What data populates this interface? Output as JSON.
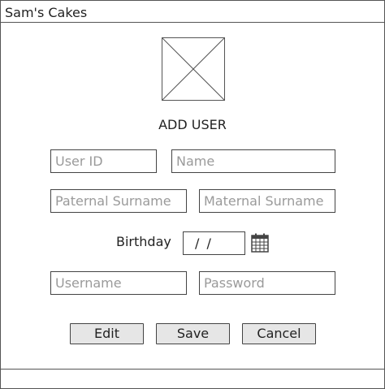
{
  "window": {
    "title": "Sam's Cakes"
  },
  "form": {
    "heading": "ADD USER",
    "avatar_icon": "image-placeholder-icon",
    "fields": {
      "user_id": {
        "placeholder": "User ID",
        "value": ""
      },
      "name": {
        "placeholder": "Name",
        "value": ""
      },
      "paternal_surname": {
        "placeholder": "Paternal Surname",
        "value": ""
      },
      "maternal_surname": {
        "placeholder": "Maternal Surname",
        "value": ""
      },
      "username": {
        "placeholder": "Username",
        "value": ""
      },
      "password": {
        "placeholder": "Password",
        "value": ""
      }
    },
    "birthday": {
      "label": "Birthday",
      "value": "/ /",
      "icon": "calendar-icon"
    }
  },
  "buttons": {
    "edit": "Edit",
    "save": "Save",
    "cancel": "Cancel"
  }
}
